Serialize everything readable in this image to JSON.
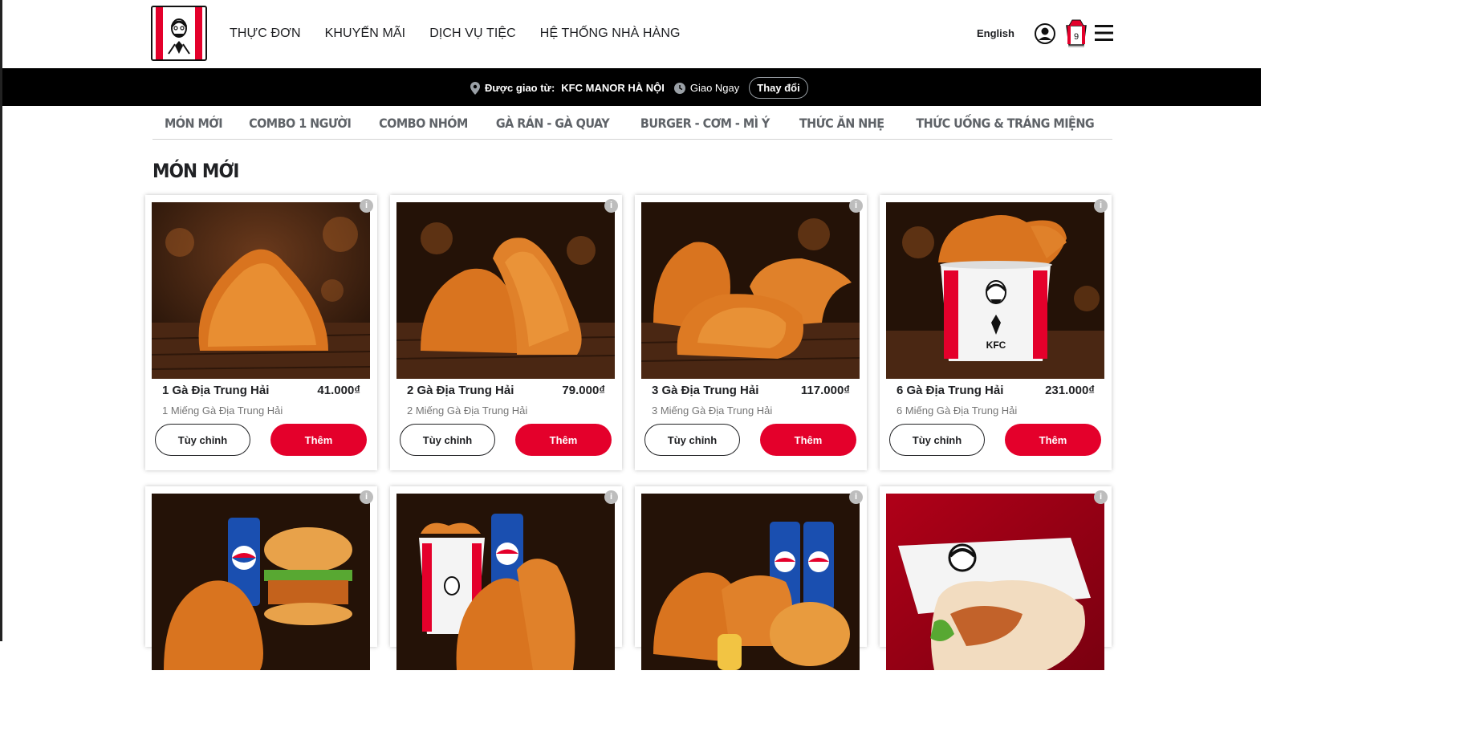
{
  "header": {
    "nav": [
      "THỰC ĐƠN",
      "KHUYẾN MÃI",
      "DỊCH VỤ TIỆC",
      "HỆ THỐNG NHÀ HÀNG"
    ],
    "language": "English",
    "cart_count": "9"
  },
  "delivery": {
    "label": "Được giao từ:",
    "store": "KFC MANOR HÀ NỘI",
    "time": "Giao Ngay",
    "change_button": "Thay đổi"
  },
  "categories": [
    "MÓN MỚI",
    "COMBO 1 NGƯỜI",
    "COMBO NHÓM",
    "GÀ RÁN - GÀ QUAY",
    "BURGER - CƠM - MÌ Ý",
    "THỨC ĂN NHẸ",
    "THỨC UỐNG & TRÁNG MIỆNG"
  ],
  "section_title": "MÓN MỚI",
  "products": [
    {
      "name": "1 Gà Địa Trung Hải",
      "price": "41.000₫",
      "description": "1 Miếng Gà Địa Trung Hải",
      "custom_label": "Tùy chỉnh",
      "add_label": "Thêm"
    },
    {
      "name": "2 Gà Địa Trung Hải",
      "price": "79.000₫",
      "description": "2 Miếng Gà Địa Trung Hải",
      "custom_label": "Tùy chỉnh",
      "add_label": "Thêm"
    },
    {
      "name": "3 Gà Địa Trung Hải",
      "price": "117.000₫",
      "description": "3 Miếng Gà Địa Trung Hải",
      "custom_label": "Tùy chỉnh",
      "add_label": "Thêm"
    },
    {
      "name": "6 Gà Địa Trung Hải",
      "price": "231.000₫",
      "description": "6 Miếng Gà Địa Trung Hải",
      "custom_label": "Tùy chỉnh",
      "add_label": "Thêm"
    }
  ],
  "bucket_brand": "KFC",
  "info_icon": "i",
  "colors": {
    "brand_red": "#e4002b",
    "bar_black": "#000000"
  }
}
